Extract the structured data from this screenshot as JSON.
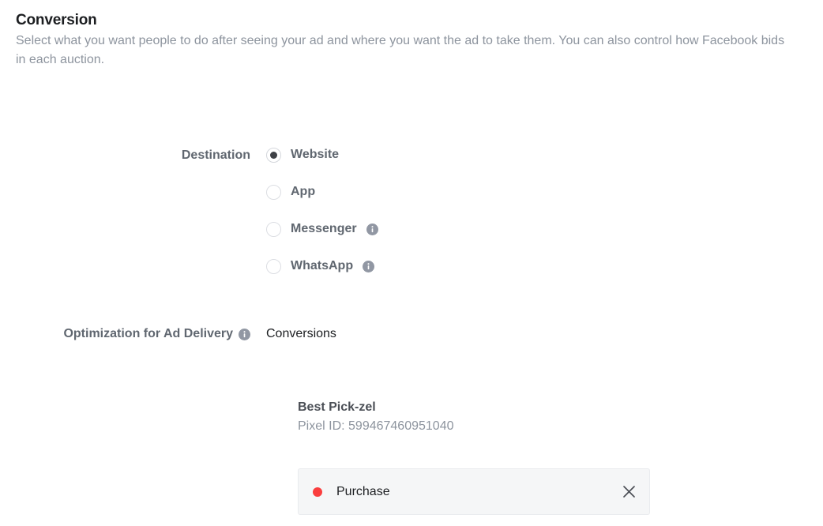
{
  "section": {
    "title": "Conversion",
    "description": "Select what you want people to do after seeing your ad and where you want the ad to take them. You can also control how Facebook bids in each auction."
  },
  "destination": {
    "label": "Destination",
    "selected": "Website",
    "options": [
      {
        "label": "Website",
        "selected": true,
        "info": false
      },
      {
        "label": "App",
        "selected": false,
        "info": false
      },
      {
        "label": "Messenger",
        "selected": false,
        "info": true
      },
      {
        "label": "WhatsApp",
        "selected": false,
        "info": true
      }
    ]
  },
  "optimization": {
    "label": "Optimization for Ad Delivery",
    "info": true,
    "value": "Conversions"
  },
  "pixel": {
    "name": "Best Pick-zel",
    "id_label": "Pixel ID: 599467460951040"
  },
  "event": {
    "label": "Purchase",
    "dot_color": "#fa3e3e",
    "remove_icon": "close-icon"
  },
  "icons": {
    "info": "info-icon",
    "close": "close-icon",
    "radio_selected": "radio-selected-icon",
    "radio_unselected": "radio-unselected-icon",
    "event_status": "status-dot-icon"
  },
  "colors": {
    "heading": "#1c1e21",
    "muted": "#8d949e",
    "label": "#606770",
    "accent_red": "#fa3e3e",
    "box_background": "#f5f6f7"
  }
}
